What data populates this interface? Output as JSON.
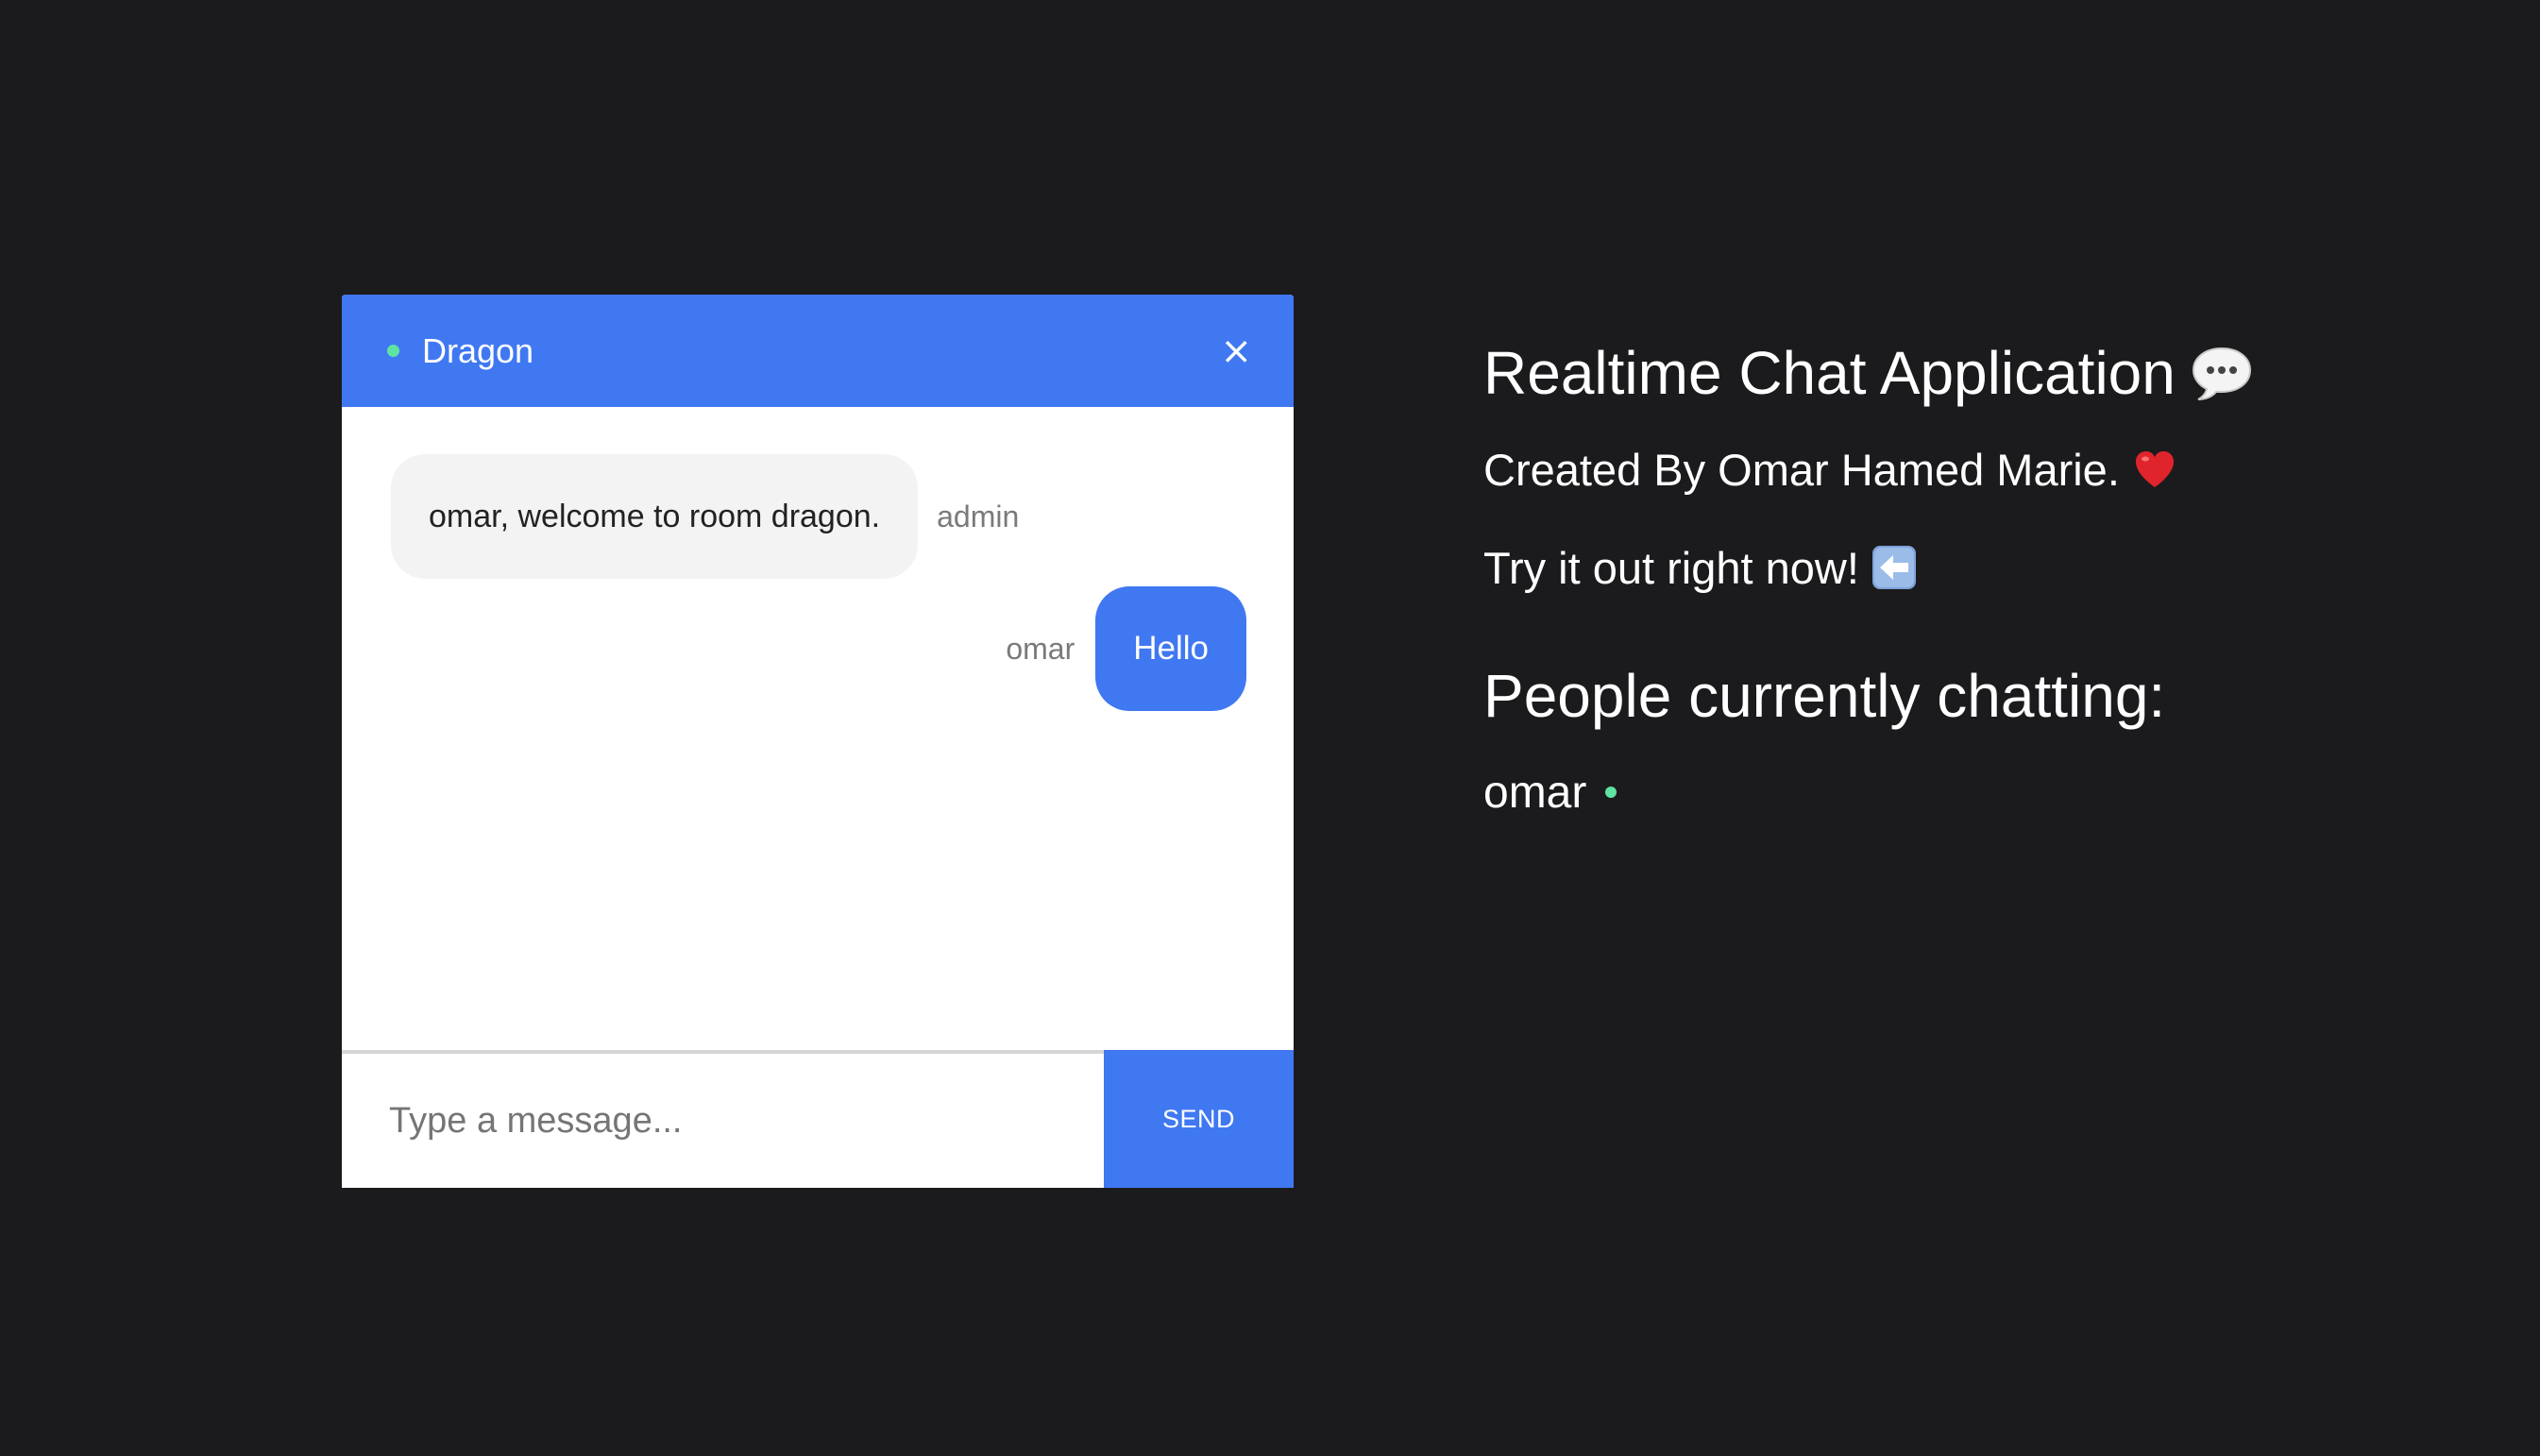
{
  "chat": {
    "room_name": "Dragon",
    "close_label": "×",
    "messages": [
      {
        "sender": "admin",
        "text": "omar, welcome to room dragon.",
        "direction": "incoming"
      },
      {
        "sender": "omar",
        "text": "Hello",
        "direction": "outgoing"
      }
    ],
    "composer": {
      "placeholder": "Type a message...",
      "value": "",
      "send_label": "SEND"
    }
  },
  "info": {
    "title": "Realtime Chat Application",
    "title_icon": "speech-bubble-icon",
    "created_by": "Created By Omar Hamed Marie.",
    "created_icon": "heart-icon",
    "try_it": "Try it out right now!",
    "try_icon": "left-arrow-icon",
    "people_heading": "People currently chatting:",
    "people": [
      {
        "name": "omar",
        "status": "online"
      }
    ]
  },
  "colors": {
    "background": "#1b1b1d",
    "accent": "#4078f2",
    "online": "#5ee3a1",
    "incoming_bubble": "#f3f3f3"
  }
}
